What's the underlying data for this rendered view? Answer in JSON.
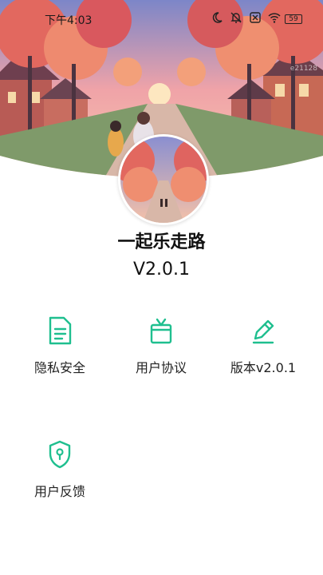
{
  "status_bar": {
    "time": "下午4:03",
    "battery": "59",
    "icons": [
      "moon-icon",
      "bell-off-icon",
      "sim-icon",
      "wifi-icon",
      "battery-icon"
    ]
  },
  "hero": {
    "watermark": "e21128"
  },
  "app": {
    "name": "一起乐走路",
    "version": "V2.0.1"
  },
  "menu": {
    "items": [
      {
        "label": "隐私安全",
        "icon": "document-icon"
      },
      {
        "label": "用户协议",
        "icon": "gift-box-icon"
      },
      {
        "label": "版本v2.0.1",
        "icon": "pencil-icon"
      },
      {
        "label": "用户反馈",
        "icon": "shield-icon"
      }
    ]
  },
  "colors": {
    "accent": "#1fbf8f"
  }
}
